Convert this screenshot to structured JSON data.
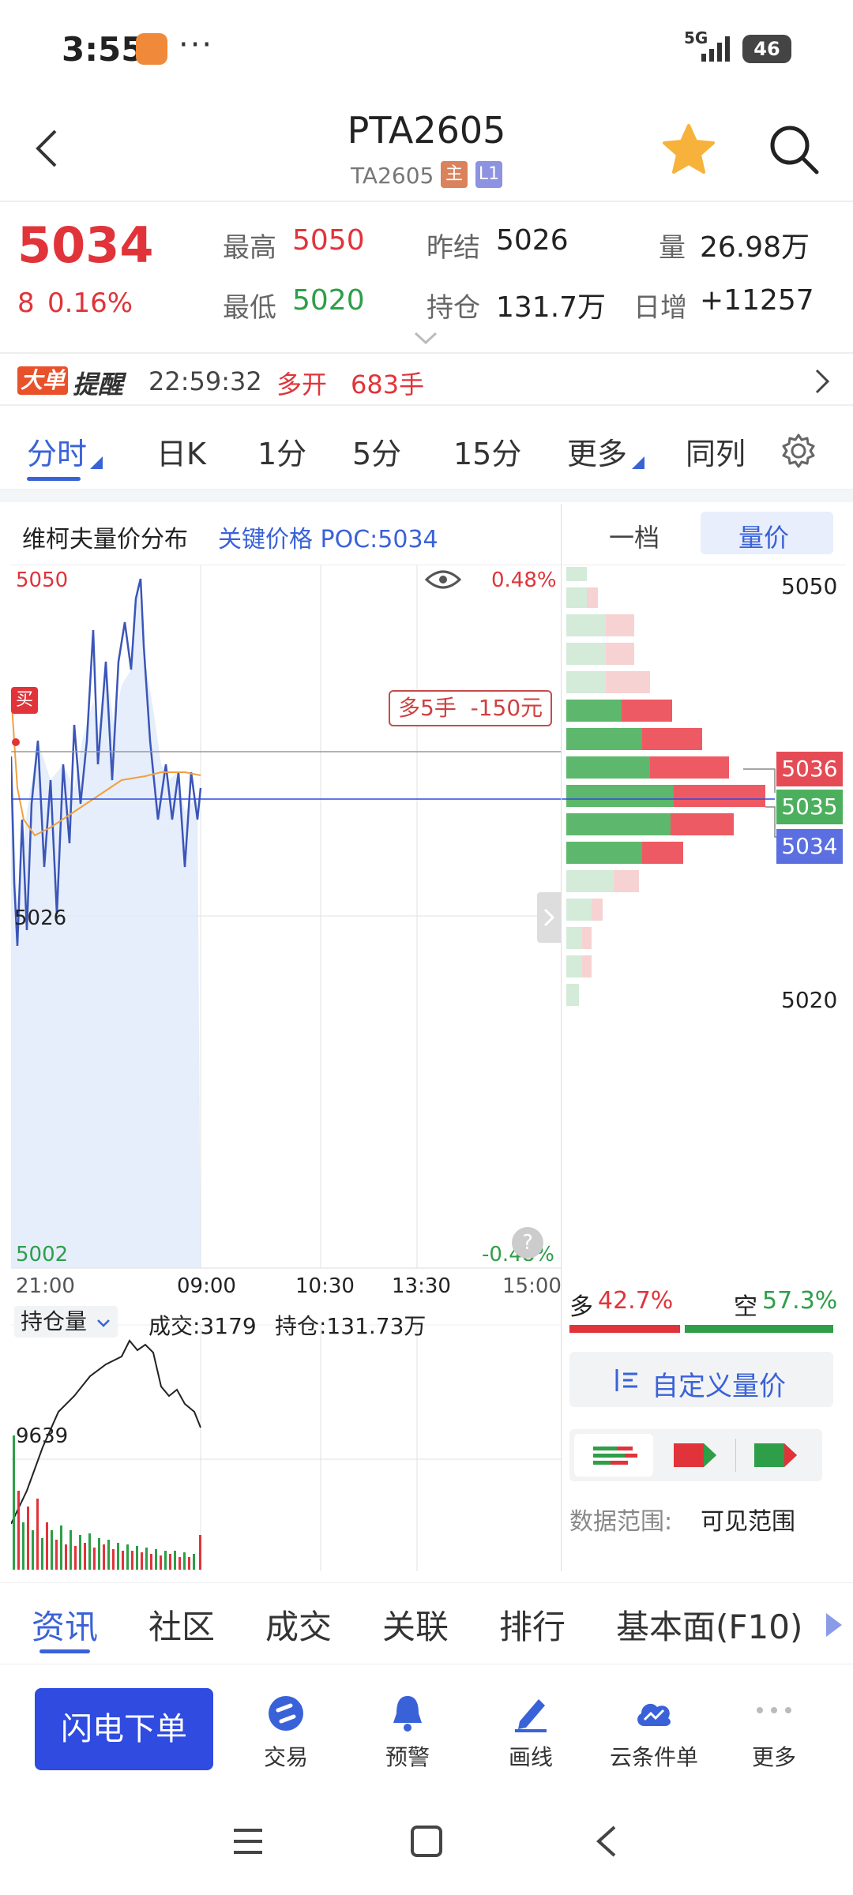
{
  "status": {
    "time": "3:55",
    "network": "5G",
    "battery": "46",
    "more": "···"
  },
  "header": {
    "title": "PTA2605",
    "subtitle": "TA2605",
    "tag_main": "主",
    "tag_l1": "L1"
  },
  "quote": {
    "price": "5034",
    "change": "8",
    "change_pct": "0.16%",
    "high_label": "最高",
    "high": "5050",
    "low_label": "最低",
    "low": "5020",
    "prev_settle_label": "昨结",
    "prev_settle": "5026",
    "oi_label": "持仓",
    "oi": "131.7万",
    "vol_label": "量",
    "vol": "26.98万",
    "daily_inc_label": "日增",
    "daily_inc": "+11257"
  },
  "alert": {
    "badge1": "大单",
    "badge2": "提醒",
    "time": "22:59:32",
    "direction": "多开",
    "lots": "683手"
  },
  "tabs": [
    "分时",
    "日K",
    "1分",
    "5分",
    "15分",
    "更多",
    "同列"
  ],
  "chart": {
    "title": "维柯夫量价分布",
    "poc": "关键价格 POC:5034",
    "top_price": "5050",
    "top_pct": "0.48%",
    "mid_price": "5026",
    "bottom_price": "5002",
    "bottom_pct": "-0.48%",
    "buy_tag": "买",
    "position_info": "多5手  -150元",
    "time_labels": [
      "21:00",
      "09:00",
      "10:30",
      "13:30",
      "15:00"
    ],
    "sub_selector": "持仓量",
    "sub_vol": "成交:3179",
    "sub_oi": "持仓:131.73万",
    "sub_label": "9639"
  },
  "right": {
    "tab1": "一档",
    "tab2": "量价",
    "price_top": "5050",
    "price_bottom": "5020",
    "tag_5036": "5036",
    "tag_5035": "5035",
    "tag_5034": "5034",
    "long_label": "多",
    "long_pct": "42.7%",
    "short_label": "空",
    "short_pct": "57.3%",
    "custom_btn": "自定义量价",
    "range_label": "数据范围:",
    "range_value": "可见范围"
  },
  "bottom_tabs": [
    "资讯",
    "社区",
    "成交",
    "关联",
    "排行",
    "基本面(F10)"
  ],
  "actions": {
    "flash_order": "闪电下单",
    "items": [
      "交易",
      "预警",
      "画线",
      "云条件单",
      "更多"
    ]
  },
  "colors": {
    "red": "#e0343a",
    "green": "#2e9e48",
    "blue": "#2f4be0",
    "accent_blue": "#3a62d8"
  }
}
